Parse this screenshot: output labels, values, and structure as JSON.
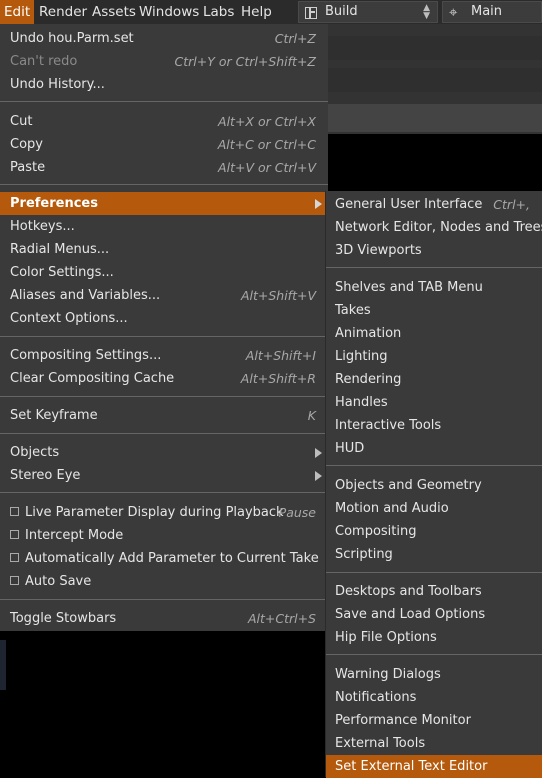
{
  "menubar": {
    "items": [
      {
        "label": "Edit",
        "active": true
      },
      {
        "label": "Render"
      },
      {
        "label": "Assets"
      },
      {
        "label": "Windows"
      },
      {
        "label": "Labs"
      },
      {
        "label": "Help"
      }
    ],
    "desktop_label": "Build",
    "pane_label": "Main"
  },
  "edit_menu": {
    "undo": {
      "label": "Undo hou.Parm.set",
      "shortcut": "Ctrl+Z"
    },
    "redo": {
      "label": "Can't redo",
      "shortcut": "Ctrl+Y or Ctrl+Shift+Z"
    },
    "undo_history": {
      "label": "Undo History..."
    },
    "cut": {
      "label": "Cut",
      "shortcut": "Alt+X or Ctrl+X"
    },
    "copy": {
      "label": "Copy",
      "shortcut": "Alt+C or Ctrl+C"
    },
    "paste": {
      "label": "Paste",
      "shortcut": "Alt+V or Ctrl+V"
    },
    "preferences": {
      "label": "Preferences"
    },
    "hotkeys": {
      "label": "Hotkeys..."
    },
    "radial_menus": {
      "label": "Radial Menus..."
    },
    "color_settings": {
      "label": "Color Settings..."
    },
    "aliases": {
      "label": "Aliases and Variables...",
      "shortcut": "Alt+Shift+V"
    },
    "context_options": {
      "label": "Context Options..."
    },
    "compositing_settings": {
      "label": "Compositing Settings...",
      "shortcut": "Alt+Shift+I"
    },
    "clear_cache": {
      "label": "Clear Compositing Cache",
      "shortcut": "Alt+Shift+R"
    },
    "set_keyframe": {
      "label": "Set Keyframe",
      "shortcut": "K"
    },
    "objects": {
      "label": "Objects"
    },
    "stereo_eye": {
      "label": "Stereo Eye"
    },
    "live_param": {
      "label": "Live Parameter Display during Playback",
      "shortcut": "Pause",
      "checked": false
    },
    "intercept": {
      "label": "Intercept Mode",
      "checked": false
    },
    "auto_add": {
      "label": "Automatically Add Parameter to Current Take",
      "checked": false
    },
    "auto_save": {
      "label": "Auto Save",
      "checked": false
    },
    "toggle_stowbars": {
      "label": "Toggle Stowbars",
      "shortcut": "Alt+Ctrl+S"
    }
  },
  "prefs_menu": {
    "general_ui": {
      "label": "General User Interface",
      "shortcut": "Ctrl+,"
    },
    "network_editor": {
      "label": "Network Editor, Nodes and Trees"
    },
    "viewports_3d": {
      "label": "3D Viewports"
    },
    "shelves": {
      "label": "Shelves and TAB Menu"
    },
    "takes": {
      "label": "Takes"
    },
    "animation": {
      "label": "Animation"
    },
    "lighting": {
      "label": "Lighting"
    },
    "rendering": {
      "label": "Rendering"
    },
    "handles": {
      "label": "Handles"
    },
    "interactive_tools": {
      "label": "Interactive Tools"
    },
    "hud": {
      "label": "HUD"
    },
    "objects_geometry": {
      "label": "Objects and Geometry"
    },
    "motion_audio": {
      "label": "Motion and Audio"
    },
    "compositing": {
      "label": "Compositing"
    },
    "scripting": {
      "label": "Scripting"
    },
    "desktops_toolbars": {
      "label": "Desktops and Toolbars"
    },
    "save_load": {
      "label": "Save and Load Options"
    },
    "hip_file": {
      "label": "Hip File Options"
    },
    "warning_dialogs": {
      "label": "Warning Dialogs"
    },
    "notifications": {
      "label": "Notifications"
    },
    "perf_monitor": {
      "label": "Performance Monitor"
    },
    "external_tools": {
      "label": "External Tools"
    },
    "ext_text_editor": {
      "label": "Set External Text Editor",
      "highlighted": true
    }
  },
  "colors": {
    "accent": "#b55a0c",
    "menu_bg": "#3a3a3a",
    "menubar_bg": "#2b2b2b"
  }
}
